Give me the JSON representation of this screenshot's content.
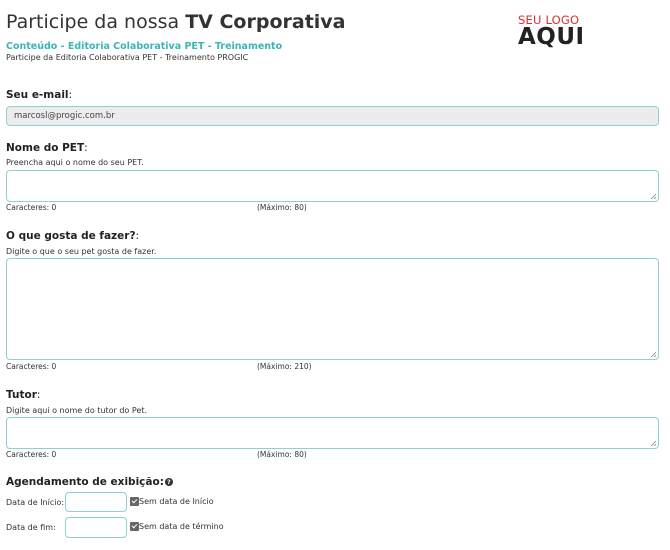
{
  "header": {
    "title_prefix": "Participe da nossa ",
    "title_bold": "TV Corporativa",
    "subtitle": "Conteúdo - Editoria Colaborativa PET - Treinamento",
    "description": "Participe da Editoria Colaborativa PET - Treinamento PROGIC"
  },
  "logo": {
    "top": "SEU LOGO",
    "bottom": "AQUI"
  },
  "email": {
    "label": "Seu e-mail",
    "value": "marcosl@progic.com.br"
  },
  "pet_name": {
    "label": "Nome do PET",
    "hint": "Preencha aqui o nome do seu PET.",
    "chars": "Caracteres: 0",
    "max": "(Máximo: 80)"
  },
  "likes": {
    "label": "O que gosta de fazer?",
    "hint": "Digite o que o seu pet gosta de fazer.",
    "chars": "Caracteres: 0",
    "max": "(Máximo: 210)"
  },
  "tutor": {
    "label": "Tutor",
    "hint": "Digite aqui o nome do tutor do Pet.",
    "chars": "Caracteres: 0",
    "max": "(Máximo: 80)"
  },
  "schedule": {
    "label": "Agendamento de exibição:",
    "help_icon": "?",
    "start_label": "Data de Início:",
    "start_checkbox": "Sem data de Início",
    "start_checked": true,
    "end_label": "Data de fim:",
    "end_checkbox": "Sem data de término",
    "end_checked": true
  },
  "colors": {
    "accent": "#3ab5b8",
    "logo_red": "#d4322f",
    "field_border": "#8fd0d3"
  }
}
